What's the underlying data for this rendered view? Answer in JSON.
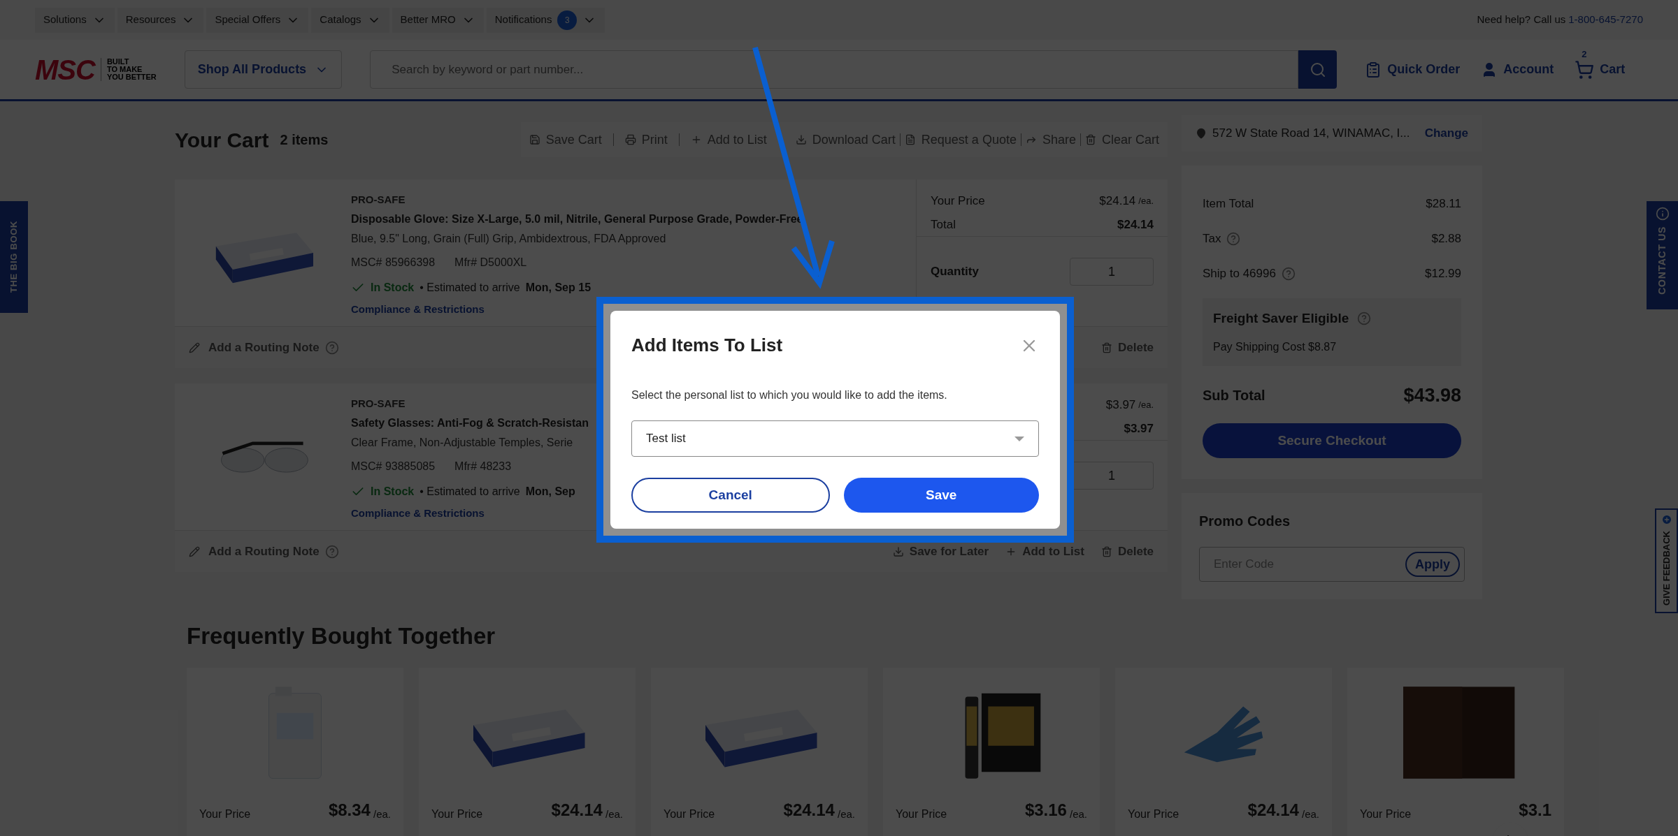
{
  "utility_bar": {
    "menus": [
      "Solutions",
      "Resources",
      "Special Offers",
      "Catalogs",
      "Better MRO"
    ],
    "notifications": {
      "label": "Notifications",
      "count": "3"
    },
    "help": "Need help? Call us",
    "phone": "1-800-645-7270"
  },
  "header": {
    "logo": "MSC",
    "tagline": [
      "BUILT",
      "TO MAKE",
      "YOU BETTER"
    ],
    "shop_all": "Shop All Products",
    "search_placeholder": "Search by keyword or part number...",
    "quick_order": "Quick Order",
    "account": "Account",
    "cart": "Cart",
    "cart_count": "2"
  },
  "cart": {
    "title": "Your Cart",
    "count": "2 items",
    "actions": [
      {
        "kind": "save",
        "label": "Save Cart"
      },
      {
        "kind": "print",
        "label": "Print"
      },
      {
        "kind": "add",
        "label": "Add to List"
      },
      {
        "kind": "download",
        "label": "Download Cart"
      },
      {
        "kind": "quote",
        "label": "Request a Quote"
      },
      {
        "kind": "share",
        "label": "Share"
      },
      {
        "kind": "delete",
        "label": "Clear Cart"
      }
    ],
    "items": [
      {
        "brand": "PRO-SAFE",
        "title": "Disposable Glove: Size X-Large, 5.0 mil, Nitrile, General Purpose Grade, Powder-Free",
        "desc": "Blue, 9.5\" Long, Grain (Full) Grip, Ambidextrous, FDA Approved",
        "msc": "MSC# 85966398",
        "mfr": "Mfr# D5000XL",
        "stock": "In Stock",
        "arrive": "• Estimated to arrive",
        "date": "Mon, Sep 15",
        "compliance": "Compliance & Restrictions",
        "price_label": "Your Price",
        "price": "$24.14",
        "unit": "/ea.",
        "total_label": "Total",
        "total": "$24.14",
        "qty_label": "Quantity",
        "qty": "1",
        "routing": "Add a Routing Note",
        "actions": [
          {
            "kind": "delete",
            "label": "Delete"
          }
        ]
      },
      {
        "brand": "PRO-SAFE",
        "title": "Safety Glasses: Anti-Fog & Scratch-Resistan",
        "desc": "Clear Frame, Non-Adjustable Temples, Serie",
        "msc": "MSC# 93885085",
        "mfr": "Mfr# 48233",
        "stock": "In Stock",
        "arrive": "• Estimated to arrive",
        "date": "Mon, Sep",
        "compliance": "Compliance & Restrictions",
        "price": "$3.97",
        "unit": "/ea.",
        "total": "$3.97",
        "qty": "1",
        "routing": "Add a Routing Note",
        "actions": [
          {
            "kind": "download",
            "label": "Save for Later"
          },
          {
            "kind": "add",
            "label": "Add to List"
          },
          {
            "kind": "delete",
            "label": "Delete"
          }
        ]
      }
    ]
  },
  "summary": {
    "address": "572 W State Road 14, WINAMAC, I...",
    "change": "Change",
    "rows": [
      {
        "label": "Item Total",
        "value": "$28.11",
        "help": false
      },
      {
        "label": "Tax",
        "value": "$2.88",
        "help": true
      },
      {
        "label": "Ship to 46996",
        "value": "$12.99",
        "help": true
      }
    ],
    "freight": {
      "title": "Freight Saver Eligible",
      "text": "Pay Shipping Cost $8.87"
    },
    "subtotal_label": "Sub Total",
    "subtotal": "$43.98",
    "checkout": "Secure Checkout"
  },
  "promo": {
    "title": "Promo Codes",
    "placeholder": "Enter Code",
    "apply": "Apply"
  },
  "side_tabs": {
    "big_book": "THE BIG BOOK",
    "contact": "CONTACT US",
    "feedback": "GIVE FEEDBACK"
  },
  "frequently_bought": {
    "title": "Frequently Bought Together",
    "cards": [
      {
        "label": "Your Price",
        "price": "$8.34",
        "unit": "/ea."
      },
      {
        "label": "Your Price",
        "price": "$24.14",
        "unit": "/ea."
      },
      {
        "label": "Your Price",
        "price": "$24.14",
        "unit": "/ea."
      },
      {
        "label": "Your Price",
        "price": "$3.16",
        "unit": "/ea."
      },
      {
        "label": "Your Price",
        "price": "$24.14",
        "unit": "/ea."
      },
      {
        "label": "Your Price",
        "price": "$3.1"
      }
    ]
  },
  "dialog": {
    "title": "Add Items To List",
    "text": "Select the personal list to which you would like to add the items.",
    "list_value": "Test list",
    "cancel": "Cancel",
    "save": "Save"
  }
}
